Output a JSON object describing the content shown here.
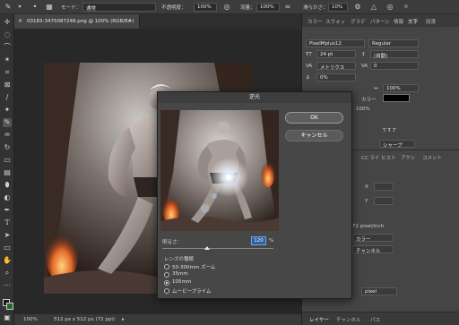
{
  "optionbar": {
    "mode_label": "モード：",
    "mode_value": "通常",
    "opacity_label": "不透明度：",
    "opacity_value": "100%",
    "flow_label": "流量：",
    "flow_value": "100%",
    "smoothing_label": "滑らかさ：",
    "smoothing_value": "10%"
  },
  "document": {
    "tab_title": "00183-3475087248.png @ 100% (RGB/8#)",
    "close_glyph": "×"
  },
  "statusbar": {
    "zoom": "100%",
    "size": "512 px x 512 px (72 ppi)"
  },
  "panels": {
    "top_tabs": [
      "カラー",
      "スウォッ",
      "グラデ",
      "パターン",
      "情報",
      "文字",
      "段落"
    ],
    "font_family": "PixelMplus12",
    "font_style": "Regular",
    "font_size": "24 pt",
    "leading": "(自動)",
    "kerning": "メトリクス",
    "tracking": "0",
    "vscale": "0%",
    "hscale": "100%",
    "color_label": "カラー",
    "opacity_pct": "100%",
    "aa_label": "シャープ",
    "mid_tabs": [
      "CC ライ",
      "ヒスト",
      "アクシ",
      "コメント"
    ],
    "x_label": "X",
    "y_label": "Y",
    "resolution": "72 pixel/inch",
    "color_mode": "カラー",
    "channel": "チャンネル",
    "unit": "pixel",
    "bottom_tabs": [
      "レイヤー",
      "チャンネル",
      "パス"
    ]
  },
  "dialog": {
    "title": "逆光",
    "ok_label": "OK",
    "cancel_label": "キャンセル",
    "brightness_label": "明るさ：",
    "brightness_value": "120",
    "brightness_unit": "%",
    "lens_type_label": "レンズの種類",
    "lens_options": [
      "50-300mm ズーム",
      "35mm",
      "105mm",
      "ムービープライム"
    ],
    "lens_selected": "105mm"
  }
}
